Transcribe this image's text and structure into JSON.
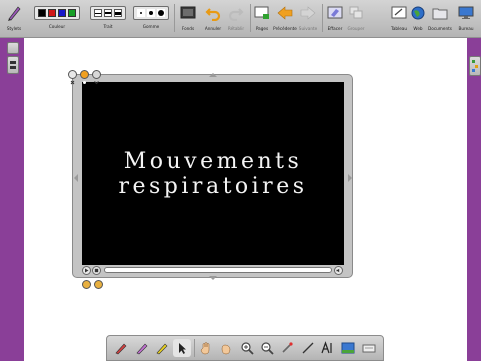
{
  "toolbar": {
    "stylets_label": "Stylets",
    "couleur_label": "Couleur",
    "colors": [
      "#000000",
      "#d01818",
      "#1818c8",
      "#18a028"
    ],
    "trait_label": "Trait",
    "gomme_label": "Gomme",
    "fonds_label": "Fonds",
    "annuler_label": "Annuler",
    "retablir_label": "Rétablir",
    "pages_label": "Pages",
    "precedente_label": "Précédente",
    "suivante_label": "Suivante",
    "effacer_label": "Effacer",
    "grouper_label": "Grouper",
    "tableau_label": "Tableau",
    "web_label": "Web",
    "documents_label": "Documents",
    "bureau_label": "Bureau"
  },
  "video": {
    "title_line1": "Mouvements",
    "title_line2": "respiratoires",
    "progress": 0.0
  },
  "icons": {
    "pen": "pen-icon",
    "undo": "undo-icon",
    "redo": "redo-icon",
    "globe": "globe-icon"
  },
  "colors": {
    "background": "#8a3f98",
    "canvas": "#ffffff",
    "toolbar": "#c4c4c4"
  }
}
